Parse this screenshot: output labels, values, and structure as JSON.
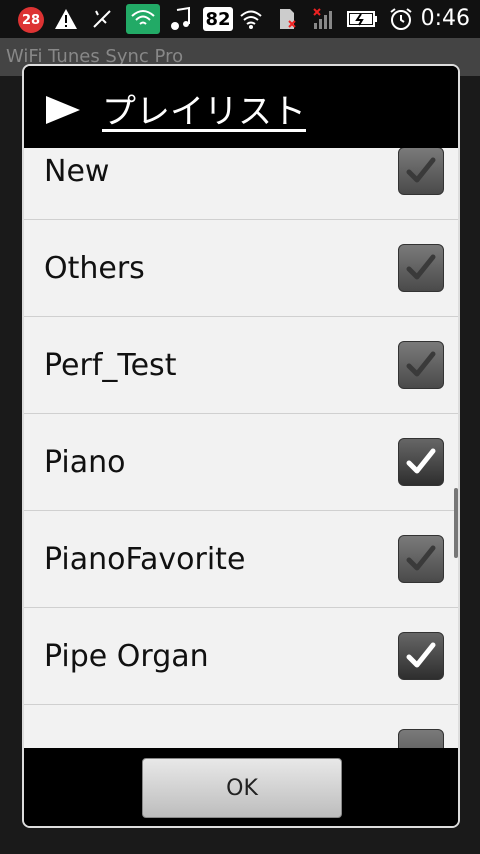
{
  "status_bar": {
    "notification_count": "28",
    "battery_percent_badge": "82",
    "time": "0:46"
  },
  "background_app": {
    "title": "WiFi Tunes Sync Pro"
  },
  "dialog": {
    "title": "プレイリスト",
    "items": [
      {
        "label": "New",
        "checked": true
      },
      {
        "label": "Others",
        "checked": true
      },
      {
        "label": "Perf_Test",
        "checked": true
      },
      {
        "label": "Piano",
        "checked": true
      },
      {
        "label": "PianoFavorite",
        "checked": true
      },
      {
        "label": "Pipe Organ",
        "checked": true
      }
    ],
    "ok_label": "OK"
  }
}
